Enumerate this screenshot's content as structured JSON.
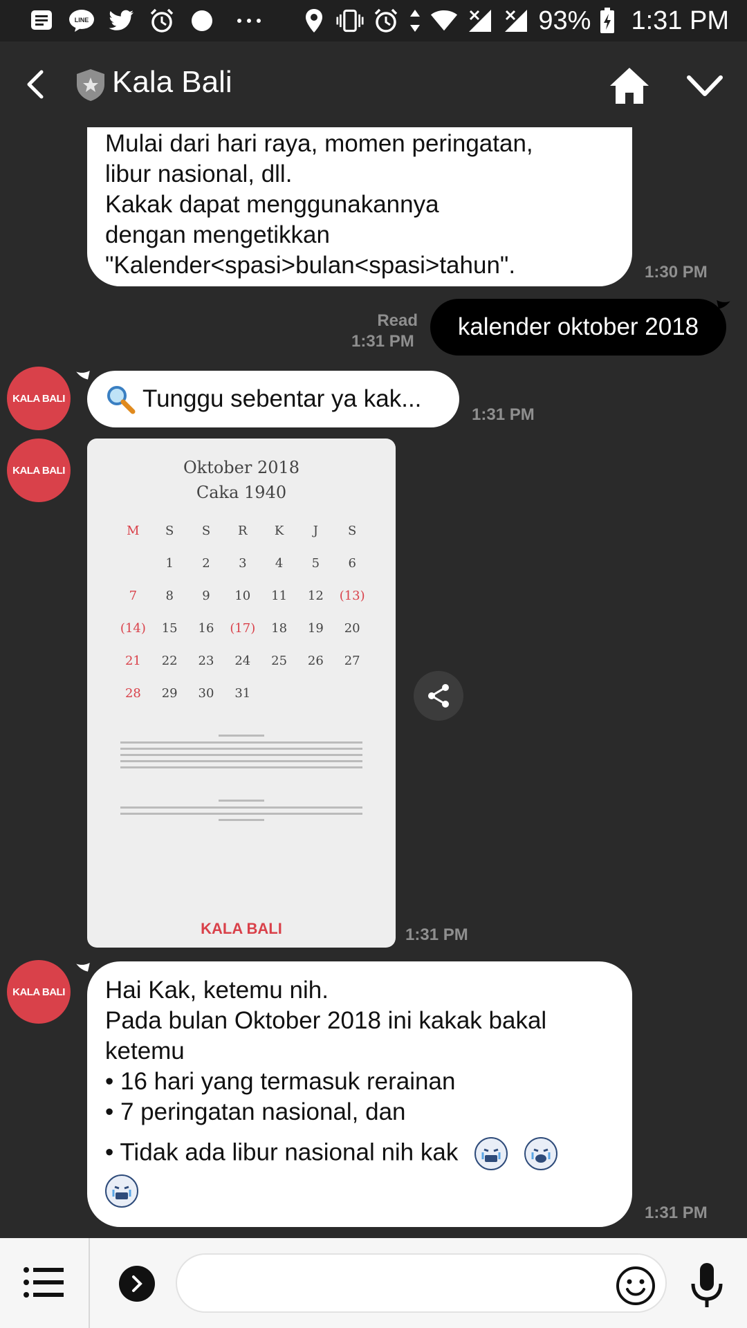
{
  "status_bar": {
    "battery": "93%",
    "time": "1:31 PM",
    "left_icons": [
      "message-icon",
      "line-app-icon",
      "twitter-icon",
      "alarm-icon",
      "circle-icon",
      "more-notifications-icon"
    ],
    "right_icons": [
      "location-icon",
      "vibrate-icon",
      "alarm-icon",
      "data-arrows-icon",
      "wifi-icon",
      "cell-signal-icon",
      "cell-signal-icon",
      "battery-charging-icon"
    ]
  },
  "header": {
    "title": "Kala Bali"
  },
  "messages": [
    {
      "lines": [
        "Mulai dari hari raya, momen peringatan,",
        "libur nasional, dll.",
        "Kakak dapat menggunakannya",
        "dengan mengetikkan",
        "\"Kalender<spasi>bulan<spasi>tahun\"."
      ],
      "time": "1:30 PM"
    },
    {
      "text": "kalender oktober 2018",
      "read": "Read",
      "time": "1:31 PM"
    },
    {
      "text": "Tunggu sebentar ya kak...",
      "time": "1:31 PM"
    },
    {
      "time": "1:31 PM"
    },
    {
      "lines": [
        "Hai Kak, ketemu nih.",
        "Pada bulan Oktober 2018 ini kakak bakal",
        "ketemu",
        "• 16 hari yang termasuk rerainan",
        "• 7 peringatan nasional, dan",
        "• Tidak ada libur nasional nih kak"
      ],
      "time": "1:31 PM"
    }
  ],
  "avatar_label": "KALA BALI",
  "calendar": {
    "title": "Oktober 2018",
    "subtitle": "Caka 1940",
    "days": [
      "M",
      "S",
      "S",
      "R",
      "K",
      "J",
      "S"
    ],
    "weeks": [
      [
        "",
        "1",
        "2",
        "3",
        "4",
        "5",
        "6"
      ],
      [
        "7",
        "8",
        "9",
        "10",
        "11",
        "12",
        "(13)"
      ],
      [
        "(14)",
        "15",
        "16",
        "(17)",
        "18",
        "19",
        "20"
      ],
      [
        "21",
        "22",
        "23",
        "24",
        "25",
        "26",
        "27"
      ],
      [
        "28",
        "29",
        "30",
        "31",
        "",
        "",
        ""
      ]
    ],
    "logo": "KALA BALI"
  },
  "colors": {
    "accent": "#d9414a",
    "background": "#2a2a2a",
    "bubble": "#ffffff",
    "sent_bubble": "#000000"
  }
}
